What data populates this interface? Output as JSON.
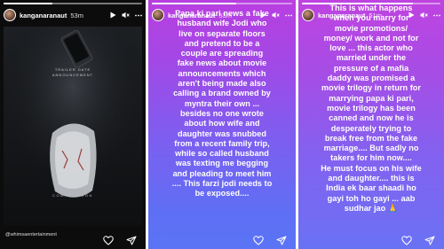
{
  "stories": [
    {
      "username": "kanganaranaut",
      "time": "53m",
      "progress": 0.35,
      "poster": {
        "title_line1": "TRAILER DATE",
        "title_line2": "ANNOUNCEMENT",
        "bottom_text": "COMING SOON",
        "handle": "@whimsaentertainment"
      }
    },
    {
      "username": "kanganaranaut",
      "time": "53m",
      "progress": 0.6,
      "text_lines": [
        "Papa ki pari news a fake",
        "husband wife Jodi who",
        "live on separate floors",
        "and pretend to be a",
        "couple are spreading",
        "fake news about movie",
        "announcements which",
        "aren't being made also",
        "calling a brand owned by",
        "myntra their own ...",
        "besides no one wrote",
        "about how wife and",
        "daughter was snubbed",
        "from a recent family trip,",
        "while so called husband",
        "was texting me begging",
        "and pleading to meet him",
        ".... This farzi jodi needs to",
        "be exposed...."
      ]
    },
    {
      "username": "kanganaranaut",
      "time": "51m",
      "progress": 0.8,
      "text_lines": [
        "This is what happens",
        "when you marry for",
        "movie promotions/",
        "money/ work and not for",
        "love ... this actor who",
        "married under the",
        "pressure of a mafia",
        "daddy was promised a",
        "movie trilogy in return for",
        "marrying papa ki pari,",
        "movie trilogy has been",
        "canned and now he is",
        "desperately trying to",
        "break free from the fake",
        "marriage.... But sadly no",
        "takers for him now....",
        "He must focus on his wife",
        "and daughter.... this is",
        "India ek baar shaadi ho",
        "gayi toh ho gayi ... aab",
        "sudhar jao 🙏"
      ]
    }
  ],
  "icons": {
    "play": "play-icon",
    "mute": "speaker-muted-icon",
    "more": "more-icon",
    "like": "heart-icon",
    "share": "send-icon"
  }
}
